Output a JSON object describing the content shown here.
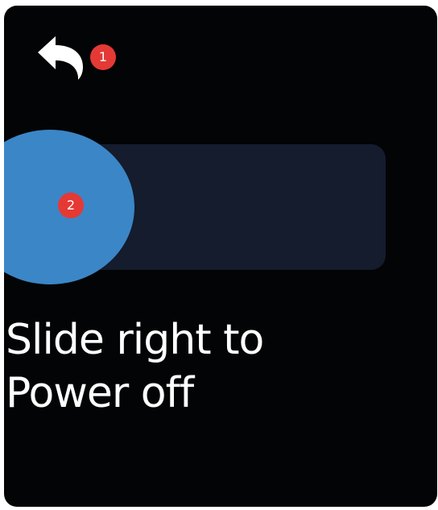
{
  "screen": {
    "background": "#030405",
    "back_icon": "undo-arrow-icon"
  },
  "badges": {
    "back": "1",
    "slider": "2"
  },
  "slider": {
    "track_color": "#141c2d",
    "knob_color": "#3b86c6",
    "progress": 0
  },
  "hint": {
    "line1": "Slide right to",
    "line2": "Power off"
  }
}
